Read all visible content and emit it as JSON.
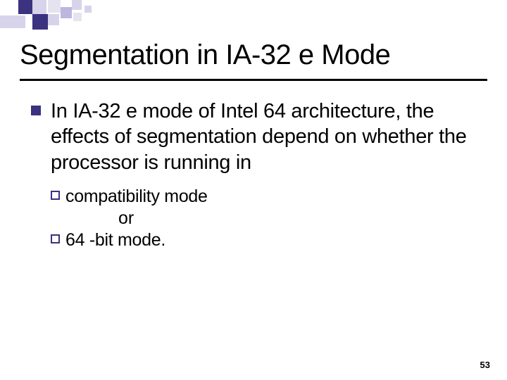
{
  "title": "Segmentation in IA-32 e Mode",
  "bullets": {
    "main": "In IA-32 e mode of Intel 64 architecture, the effects of segmentation depend on whether the processor is running in",
    "sub1": "compatibility mode",
    "or": "or",
    "sub2": "64 -bit mode."
  },
  "page_number": "53"
}
